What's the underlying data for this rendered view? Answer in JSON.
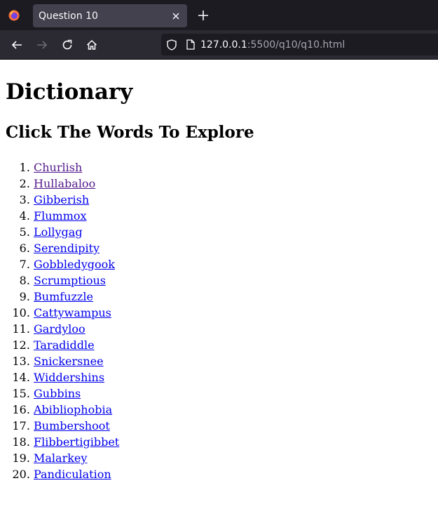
{
  "browser": {
    "tab_title": "Question 10",
    "url_host": "127.0.0.1",
    "url_rest": ":5500/q10/q10.html"
  },
  "page": {
    "heading": "Dictionary",
    "subheading": "Click The Words To Explore",
    "words": [
      {
        "label": "Churlish",
        "visited": true
      },
      {
        "label": "Hullabaloo",
        "visited": true
      },
      {
        "label": "Gibberish",
        "visited": false
      },
      {
        "label": "Flummox",
        "visited": false
      },
      {
        "label": "Lollygag",
        "visited": false
      },
      {
        "label": "Serendipity",
        "visited": false
      },
      {
        "label": "Gobbledygook",
        "visited": false
      },
      {
        "label": "Scrumptious",
        "visited": false
      },
      {
        "label": "Bumfuzzle",
        "visited": false
      },
      {
        "label": "Cattywampus",
        "visited": false
      },
      {
        "label": "Gardyloo",
        "visited": false
      },
      {
        "label": "Taradiddle",
        "visited": false
      },
      {
        "label": "Snickersnee",
        "visited": false
      },
      {
        "label": "Widdershins",
        "visited": false
      },
      {
        "label": "Gubbins",
        "visited": false
      },
      {
        "label": "Abibliophobia",
        "visited": false
      },
      {
        "label": "Bumbershoot",
        "visited": false
      },
      {
        "label": "Flibbertigibbet",
        "visited": false
      },
      {
        "label": "Malarkey",
        "visited": false
      },
      {
        "label": "Pandiculation",
        "visited": false
      }
    ]
  },
  "colors": {
    "link": "#0000ee",
    "visited_link": "#551a8b",
    "chrome_dark": "#1c1b22",
    "chrome_tab": "#42414d"
  }
}
